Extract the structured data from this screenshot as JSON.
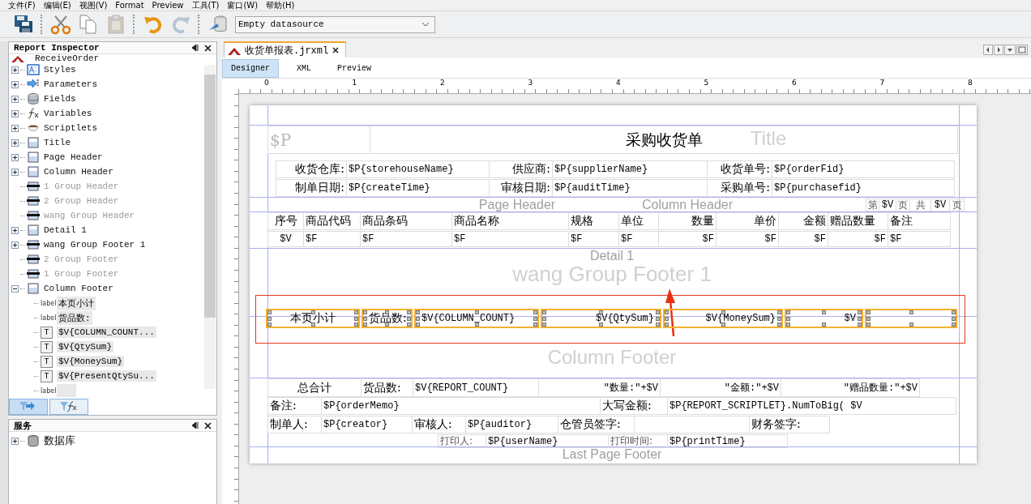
{
  "menu": [
    "文件(F)",
    "编辑(E)",
    "视图(V)",
    "Format",
    "Preview",
    "工具(T)",
    "窗口(W)",
    "帮助(H)"
  ],
  "toolbar": {
    "buttons": [
      {
        "kind": "save",
        "disabled": false
      },
      {
        "kind": "cut",
        "disabled": false
      },
      {
        "kind": "copy",
        "disabled": false
      },
      {
        "kind": "paste",
        "disabled": true
      },
      {
        "kind": "undo",
        "disabled": false
      },
      {
        "kind": "redo",
        "disabled": true
      },
      {
        "kind": "datasource",
        "disabled": false
      }
    ],
    "datasource": "Empty datasource"
  },
  "inspector": {
    "title": "Report Inspector",
    "root": "ReceiveOrder",
    "items": [
      {
        "label": "Styles",
        "kind": "styles",
        "disabled": false,
        "expanded": false
      },
      {
        "label": "Parameters",
        "kind": "parameters",
        "disabled": false,
        "expanded": false
      },
      {
        "label": "Fields",
        "kind": "fields",
        "disabled": false,
        "expanded": false
      },
      {
        "label": "Variables",
        "kind": "variables",
        "disabled": false,
        "expanded": false
      },
      {
        "label": "Scriptlets",
        "kind": "scriptlets",
        "disabled": false,
        "expanded": false
      },
      {
        "label": "Title",
        "kind": "band",
        "disabled": false,
        "expanded": false
      },
      {
        "label": "Page Header",
        "kind": "band",
        "disabled": false,
        "expanded": false
      },
      {
        "label": "Column Header",
        "kind": "band",
        "disabled": false,
        "expanded": false
      },
      {
        "label": "1 Group Header",
        "kind": "group",
        "disabled": true
      },
      {
        "label": "2 Group Header",
        "kind": "group",
        "disabled": true
      },
      {
        "label": "wang Group Header",
        "kind": "group",
        "disabled": true
      },
      {
        "label": "Detail 1",
        "kind": "band",
        "disabled": false,
        "expanded": false
      },
      {
        "label": "wang Group Footer 1",
        "kind": "group",
        "disabled": false,
        "expanded": false
      },
      {
        "label": "2 Group Footer",
        "kind": "group",
        "disabled": true
      },
      {
        "label": "1 Group Footer",
        "kind": "group",
        "disabled": true
      },
      {
        "label": "Column Footer",
        "kind": "band",
        "disabled": false,
        "expanded": true,
        "children": [
          {
            "kind": "label",
            "icon_text": "label",
            "label": "本页小计"
          },
          {
            "kind": "label",
            "icon_text": "label",
            "label": "货品数:"
          },
          {
            "kind": "textfield",
            "icon_text": "T",
            "label": "$V{COLUMN_COUNT..."
          },
          {
            "kind": "textfield",
            "icon_text": "T",
            "label": "$V{QtySum}"
          },
          {
            "kind": "textfield",
            "icon_text": "T",
            "label": "$V{MoneySum}"
          },
          {
            "kind": "textfield",
            "icon_text": "T",
            "label": "$V{PresentQtySu..."
          },
          {
            "kind": "label",
            "icon_text": "label"
          }
        ]
      }
    ]
  },
  "services": {
    "title": "服务",
    "items": [
      {
        "label": "数据库",
        "expanded": false
      }
    ]
  },
  "editor": {
    "tab": "收货单报表.jrxml",
    "views": [
      {
        "label": "Designer",
        "selected": true
      },
      {
        "label": "XML",
        "selected": false
      },
      {
        "label": "Preview",
        "selected": false
      }
    ],
    "ruler": [
      "0",
      "1",
      "2",
      "3",
      "4",
      "5",
      "6",
      "7",
      "8"
    ],
    "bands": [
      "Title",
      "Page Header",
      "Column Header",
      "Detail 1",
      "wang Group Footer 1",
      "Column Footer",
      "Last Page Footer"
    ],
    "page_number": [
      "第",
      "$V",
      "页",
      "共",
      "$V",
      "页"
    ],
    "title_row": [
      {
        "text": "$P",
        "kind": "ghost"
      },
      {
        "text": "采购收货单",
        "kind": "title"
      }
    ],
    "info_rows": [
      {
        "selected": false,
        "cells": [
          {
            "text": "收货仓库:",
            "kind": "label"
          },
          {
            "text": "$P{storehouseName}",
            "kind": "expr"
          },
          {
            "text": "供应商:",
            "kind": "label"
          },
          {
            "text": "$P{supplierName}",
            "kind": "expr"
          },
          {
            "text": "收货单号:",
            "kind": "label"
          },
          {
            "text": "$P{orderFid}",
            "kind": "expr"
          }
        ]
      },
      {
        "selected": false,
        "cells": [
          {
            "text": "制单日期:",
            "kind": "label"
          },
          {
            "text": "$P{createTime}",
            "kind": "expr"
          },
          {
            "text": "审核日期:",
            "kind": "label"
          },
          {
            "text": "$P{auditTime}",
            "kind": "expr"
          },
          {
            "text": "采购单号:",
            "kind": "label"
          },
          {
            "text": "$P{purchasefid}",
            "kind": "expr"
          }
        ]
      }
    ],
    "table": {
      "header": [
        {
          "text": "序号",
          "kind": "label"
        },
        {
          "text": "商品代码",
          "kind": "label"
        },
        {
          "text": "商品条码",
          "kind": "label"
        },
        {
          "text": "商品名称",
          "kind": "label"
        },
        {
          "text": "规格",
          "kind": "label"
        },
        {
          "text": "单位",
          "kind": "label"
        },
        {
          "text": "数量",
          "kind": "label"
        },
        {
          "text": "单价",
          "kind": "label"
        },
        {
          "text": "金额",
          "kind": "label"
        },
        {
          "text": "赠品数量",
          "kind": "label"
        },
        {
          "text": "备注",
          "kind": "label"
        }
      ],
      "detail": [
        {
          "text": "$V",
          "kind": "expr"
        },
        {
          "text": "$F",
          "kind": "expr"
        },
        {
          "text": "$F",
          "kind": "expr"
        },
        {
          "text": "$F",
          "kind": "expr"
        },
        {
          "text": "$F",
          "kind": "expr"
        },
        {
          "text": "$F",
          "kind": "expr"
        },
        {
          "text": "$F",
          "kind": "expr"
        },
        {
          "text": "$F",
          "kind": "expr"
        },
        {
          "text": "$F",
          "kind": "expr"
        },
        {
          "text": "$F",
          "kind": "expr"
        },
        {
          "text": "$F",
          "kind": "expr"
        }
      ]
    },
    "column_footer": {
      "selected": true,
      "cells": [
        {
          "text": "本页小计",
          "kind": "label"
        },
        {
          "text": "货品数:",
          "kind": "label"
        },
        {
          "text": "$V{COLUMN_COUNT}",
          "kind": "expr"
        },
        {
          "text": "$V{QtySum}",
          "kind": "expr"
        },
        {
          "text": "$V{MoneySum}",
          "kind": "expr"
        },
        {
          "text": "$V",
          "kind": "expr"
        },
        {
          "kind": "expr"
        }
      ]
    },
    "footer_rows": [
      {
        "selected": false,
        "cells": [
          {
            "text": "总合计",
            "kind": "label"
          },
          {
            "text": "货品数:",
            "kind": "label"
          },
          {
            "text": "$V{REPORT_COUNT}",
            "kind": "expr"
          },
          {
            "text": "\"数量:\"+$V",
            "kind": "expr"
          },
          {
            "text": "\"金额:\"+$V",
            "kind": "expr"
          },
          {
            "text": "\"赠品数量:\"+$V",
            "kind": "expr"
          }
        ]
      },
      {
        "selected": false,
        "cells": [
          {
            "text": "备注:",
            "kind": "label"
          },
          {
            "text": "$P{orderMemo}",
            "kind": "expr"
          },
          {
            "text": "大写金额:",
            "kind": "label"
          },
          {
            "text": "$P{REPORT_SCRIPTLET}.NumToBig( $V",
            "kind": "expr"
          }
        ]
      },
      {
        "selected": false,
        "cells": [
          {
            "text": "制单人:",
            "kind": "label"
          },
          {
            "text": "$P{creator}",
            "kind": "expr"
          },
          {
            "text": "审核人:",
            "kind": "label"
          },
          {
            "text": "$P{auditor}",
            "kind": "expr"
          },
          {
            "text": "仓管员签字:",
            "kind": "label"
          },
          {
            "kind": "expr"
          },
          {
            "text": "财务签字:",
            "kind": "label"
          }
        ]
      },
      {
        "selected": false,
        "cells": [
          {
            "text": "打印人:",
            "kind": "small"
          },
          {
            "text": "$P{userName}",
            "kind": "expr"
          },
          {
            "text": "打印时间:",
            "kind": "small"
          },
          {
            "text": "$P{printTime}",
            "kind": "expr"
          }
        ]
      }
    ]
  }
}
